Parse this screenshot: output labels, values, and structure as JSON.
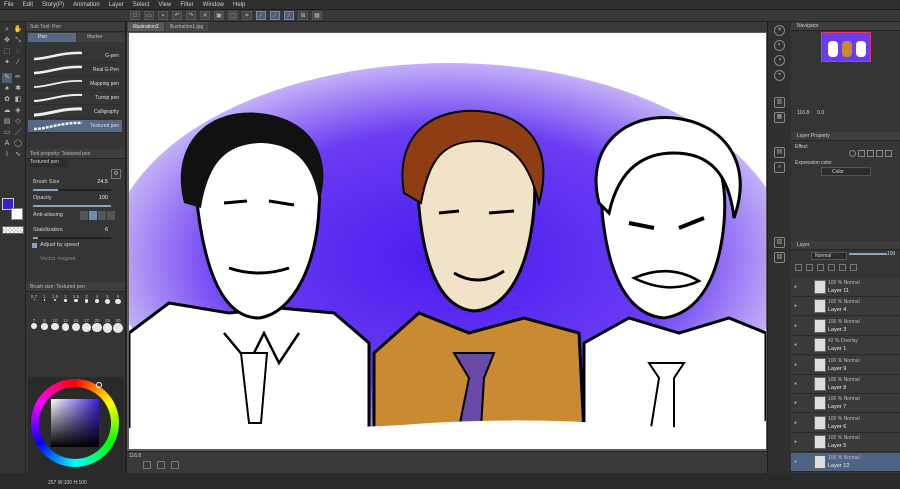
{
  "menu": [
    "File",
    "Edit",
    "Story(P)",
    "Animation",
    "Layer",
    "Select",
    "View",
    "Filter",
    "Window",
    "Help"
  ],
  "tool_tabs": {
    "subtool_title": "Sub Tool: Pen",
    "tab_pen": "Pen",
    "tab_marker": "Marker"
  },
  "brushes": [
    "G-pen",
    "Real G-Pen",
    "Mapping pen",
    "Turnip pen",
    "Calligraphy",
    "Textured pen"
  ],
  "tool_property": {
    "title": "Tool property: Textured pen",
    "name": "Textured pen",
    "brush_size_label": "Brush Size",
    "brush_size_value": "24.5",
    "opacity_label": "Opacity",
    "opacity_value": "100",
    "antialias_label": "Anti-aliasing",
    "stabilization_label": "Stabilization",
    "stabilization_value": "6",
    "adjust_speed_label": "Adjust by speed",
    "vector_magnet_label": "Vector magnet"
  },
  "brush_size_panel": {
    "title": "Brush size: Textured pen",
    "sizes": [
      "0.7",
      "1",
      "1.5",
      "2",
      "2.5",
      "3",
      "4",
      "5",
      "6",
      "7",
      "8",
      "10",
      "12",
      "15",
      "17",
      "20",
      "25",
      "30"
    ]
  },
  "color_status": "257 W:100 H:100",
  "doc_tabs": [
    "Illustration3",
    "Illustration1.jpg"
  ],
  "status_zoom": "116.8",
  "navigator": {
    "title": "Navigator",
    "zoom": "116.8",
    "angle": "0.0"
  },
  "layer_property": {
    "title": "Layer Property",
    "effect_label": "Effect",
    "expression_label": "Expression color",
    "expression_value": "Color"
  },
  "layer_panel": {
    "title": "Layer",
    "blend": "Normal",
    "opacity": "100",
    "layers": [
      {
        "mode": "100 % Normal",
        "name": "Layer 11"
      },
      {
        "mode": "100 % Normal",
        "name": "Layer 4"
      },
      {
        "mode": "100 % Normal",
        "name": "Layer 3"
      },
      {
        "mode": "42 % Overlay",
        "name": "Layer 1"
      },
      {
        "mode": "100 % Normal",
        "name": "Layer 9"
      },
      {
        "mode": "100 % Normal",
        "name": "Layer 8"
      },
      {
        "mode": "100 % Normal",
        "name": "Layer 7"
      },
      {
        "mode": "100 % Normal",
        "name": "Layer 6"
      },
      {
        "mode": "100 % Normal",
        "name": "Layer 5"
      },
      {
        "mode": "100 % Normal",
        "name": "Layer 12"
      }
    ]
  },
  "colors": {
    "accent": "#546a86",
    "main_color": "#3a1fd8",
    "glow": "#5b2bf0",
    "shirt": "#c98a32",
    "tie": "#6a4aa8"
  }
}
